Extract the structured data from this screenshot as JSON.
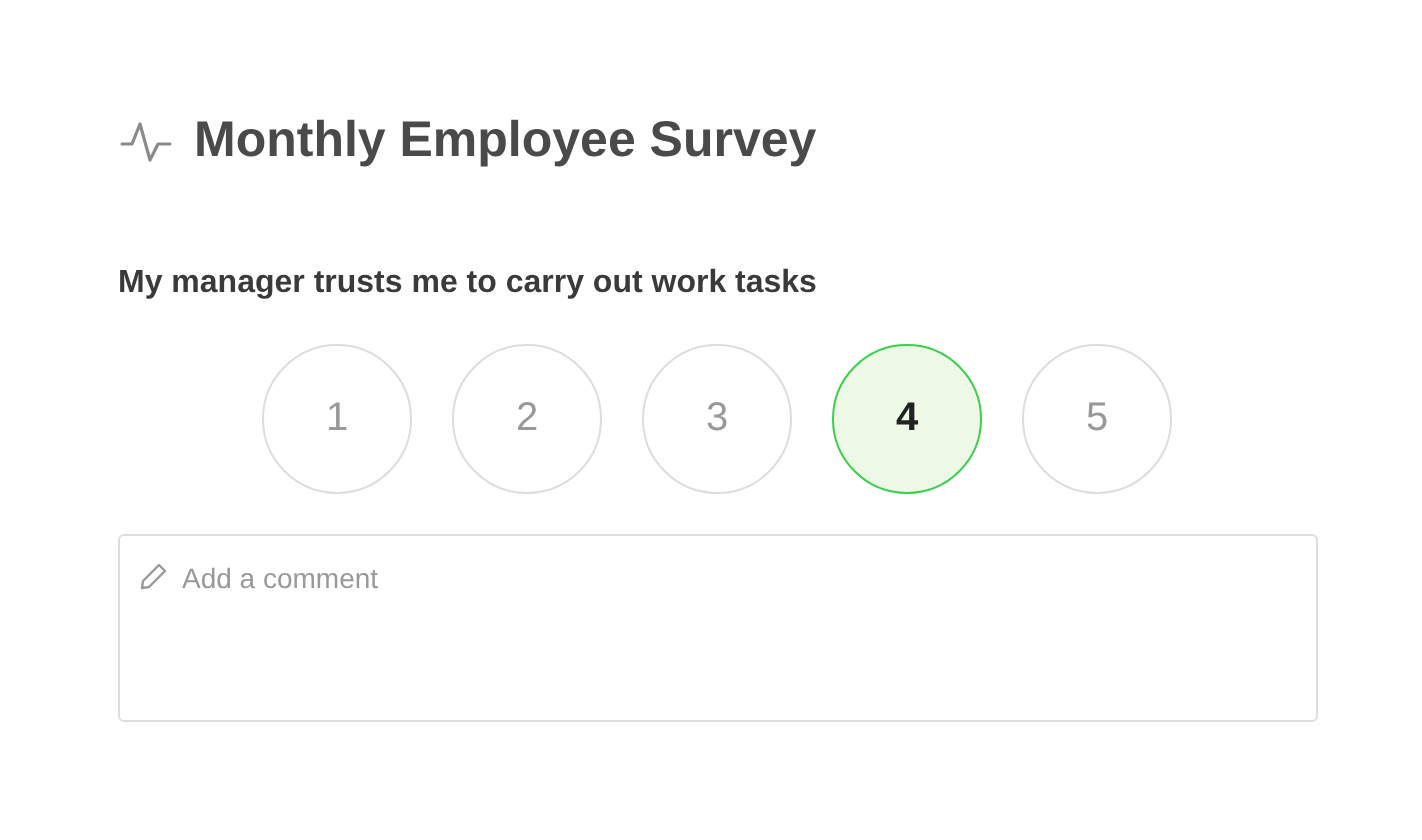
{
  "title": "Monthly Employee Survey",
  "question": "My manager trusts me to carry out work tasks",
  "ratings": [
    {
      "label": "1",
      "selected": false
    },
    {
      "label": "2",
      "selected": false
    },
    {
      "label": "3",
      "selected": false
    },
    {
      "label": "4",
      "selected": true
    },
    {
      "label": "5",
      "selected": false
    }
  ],
  "comment": {
    "placeholder": "Add a comment"
  }
}
